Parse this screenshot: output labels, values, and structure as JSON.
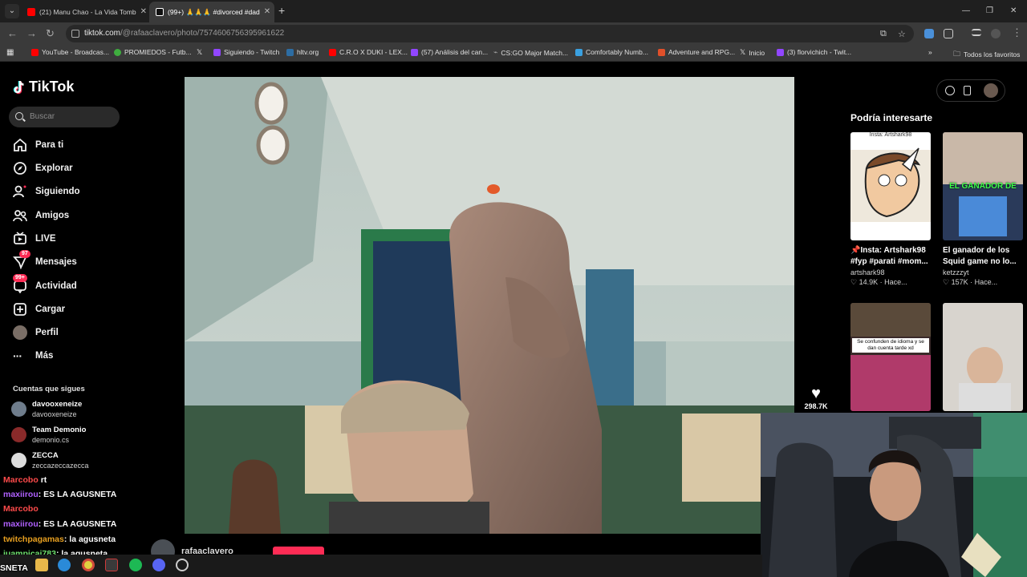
{
  "browser": {
    "tabs": [
      {
        "title": "(21) Manu Chao - La Vida Tomb",
        "active": false
      },
      {
        "title": "(99+) 🙏🙏🙏 #divorced #dad",
        "active": true
      }
    ],
    "url_domain": "tiktok.com",
    "url_path": "/@rafaaclavero/photo/7574606756395961622",
    "bookmarks": [
      "YouTube - Broadcas...",
      "PROMIEDOS - Futb...",
      "Siguiendo - Twitch",
      "hltv.org",
      "C.R.O X DUKI - LEX...",
      "(57) Análisis del can...",
      "CS:GO Major Match...",
      "Comfortably Numb...",
      "Adventure and RPG...",
      "Inicio",
      "(3) florvichich - Twit..."
    ],
    "bookmarks_folder": "Todos los favoritos"
  },
  "tiktok": {
    "logo": "TikTok",
    "search_placeholder": "Buscar",
    "nav": [
      {
        "label": "Para ti",
        "icon": "home-icon"
      },
      {
        "label": "Explorar",
        "icon": "compass-icon"
      },
      {
        "label": "Siguiendo",
        "icon": "following-icon"
      },
      {
        "label": "Amigos",
        "icon": "friends-icon"
      },
      {
        "label": "LIVE",
        "icon": "live-icon"
      },
      {
        "label": "Mensajes",
        "icon": "messages-icon",
        "badge": "97"
      },
      {
        "label": "Actividad",
        "icon": "activity-icon",
        "badge": "99+"
      },
      {
        "label": "Cargar",
        "icon": "upload-icon"
      },
      {
        "label": "Perfil",
        "icon": "profile-icon"
      },
      {
        "label": "Más",
        "icon": "more-icon"
      }
    ],
    "following_title": "Cuentas que sigues",
    "following": [
      {
        "name": "davooxeneize",
        "handle": "davooxeneize"
      },
      {
        "name": "Team Demonio",
        "handle": "demonio.cs"
      },
      {
        "name": "ZECCA",
        "handle": "zeccazeccazecca"
      }
    ],
    "likes": "298.7K",
    "author": "rafaaclavero",
    "recommend_title": "Podría interesarte",
    "cards": [
      {
        "caption1": "📌Insta: Artshark98",
        "caption2": "#fyp #parati #mom...",
        "author": "artshark98",
        "likes": "14.9K",
        "time": "Hace...",
        "thumb_text": "Insta: Artshark98"
      },
      {
        "caption1": "El ganador de los",
        "caption2": "Squid game no lo...",
        "author": "ketzzzyt",
        "likes": "157K",
        "time": "Hace...",
        "thumb_text": "EL GANADOR DE"
      },
      {
        "thumb_text": "Se confunden de idioma y se dan cuenta tarde xd"
      },
      {
        "thumb_text": ""
      }
    ]
  },
  "chat": [
    {
      "user": "Marcobo",
      "msg": "rt",
      "color": "#ff4b4b"
    },
    {
      "user": "maxiirou",
      "msg": ": ES LA AGUSNETA",
      "color": "#b061ff"
    },
    {
      "user": "Marcobo",
      "msg": "",
      "color": "#ff4b4b"
    },
    {
      "user": "maxiirou",
      "msg": ": ES LA AGUSNETA",
      "color": "#b061ff"
    },
    {
      "user": "twitchpagamas",
      "msg": ": la agusneta",
      "color": "#e8a020"
    },
    {
      "user": "juampicai783",
      "msg": ": la agusneta",
      "color": "#6ee06e"
    },
    {
      "user": "",
      "msg": "SNETA",
      "color": "#ffffff"
    }
  ]
}
